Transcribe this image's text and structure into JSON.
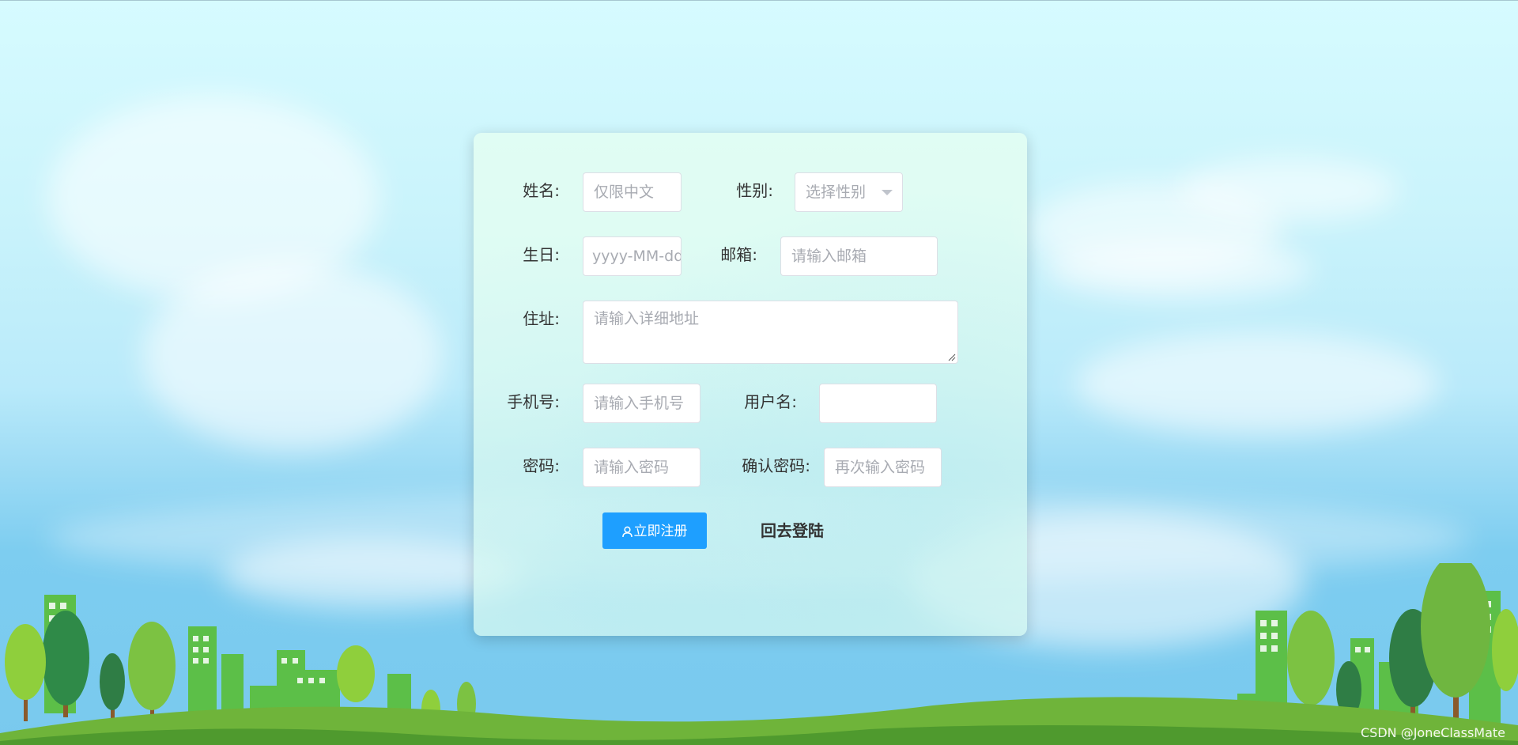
{
  "form": {
    "name_label": "姓名:",
    "name_placeholder": "仅限中文",
    "gender_label": "性别:",
    "gender_selected": "选择性别",
    "birthday_label": "生日:",
    "birthday_placeholder": "yyyy-MM-dd",
    "email_label": "邮箱:",
    "email_placeholder": "请输入邮箱",
    "address_label": "住址:",
    "address_placeholder": "请输入详细地址",
    "phone_label": "手机号:",
    "phone_placeholder": "请输入手机号",
    "username_label": "用户名:",
    "username_value": "",
    "password_label": "密码:",
    "password_placeholder": "请输入密码",
    "confirm_label": "确认密码:",
    "confirm_placeholder": "再次输入密码"
  },
  "actions": {
    "register_label": "立即注册",
    "back_label": "回去登陆"
  },
  "watermark": "CSDN @JoneClassMate",
  "colors": {
    "primary": "#1e9fff",
    "sky": "#c9f3fb",
    "card": "#e8fff0"
  }
}
